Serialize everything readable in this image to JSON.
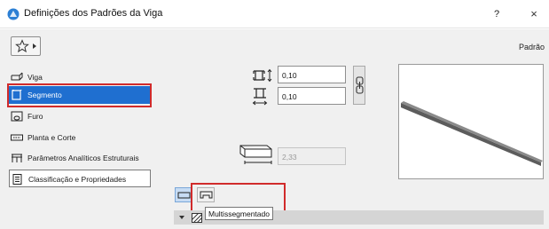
{
  "window": {
    "title": "Definições dos Padrões da Viga",
    "help_label": "?",
    "close_label": "×"
  },
  "toolbar": {
    "preset_label": "Padrão"
  },
  "sidebar": {
    "items": [
      {
        "label": "Viga",
        "icon": "beam-icon",
        "active": false
      },
      {
        "label": "Segmento",
        "icon": "segment-icon",
        "active": true
      },
      {
        "label": "Furo",
        "icon": "hole-icon",
        "active": false
      },
      {
        "label": "Planta e Corte",
        "icon": "plan-section-icon",
        "active": false
      },
      {
        "label": "Parâmetros Analíticos Estruturais",
        "icon": "structural-analytical-icon",
        "active": false
      },
      {
        "label": "Classificação e Propriedades",
        "icon": "classification-icon",
        "active": false
      }
    ]
  },
  "segment": {
    "width_value": "0,10",
    "height_value": "0,10",
    "length_value": "2,33"
  },
  "geometry": {
    "tooltip": "Multissegmentado"
  },
  "colors": {
    "active_item": "#1f6fd0",
    "highlight": "#d12b2b"
  }
}
